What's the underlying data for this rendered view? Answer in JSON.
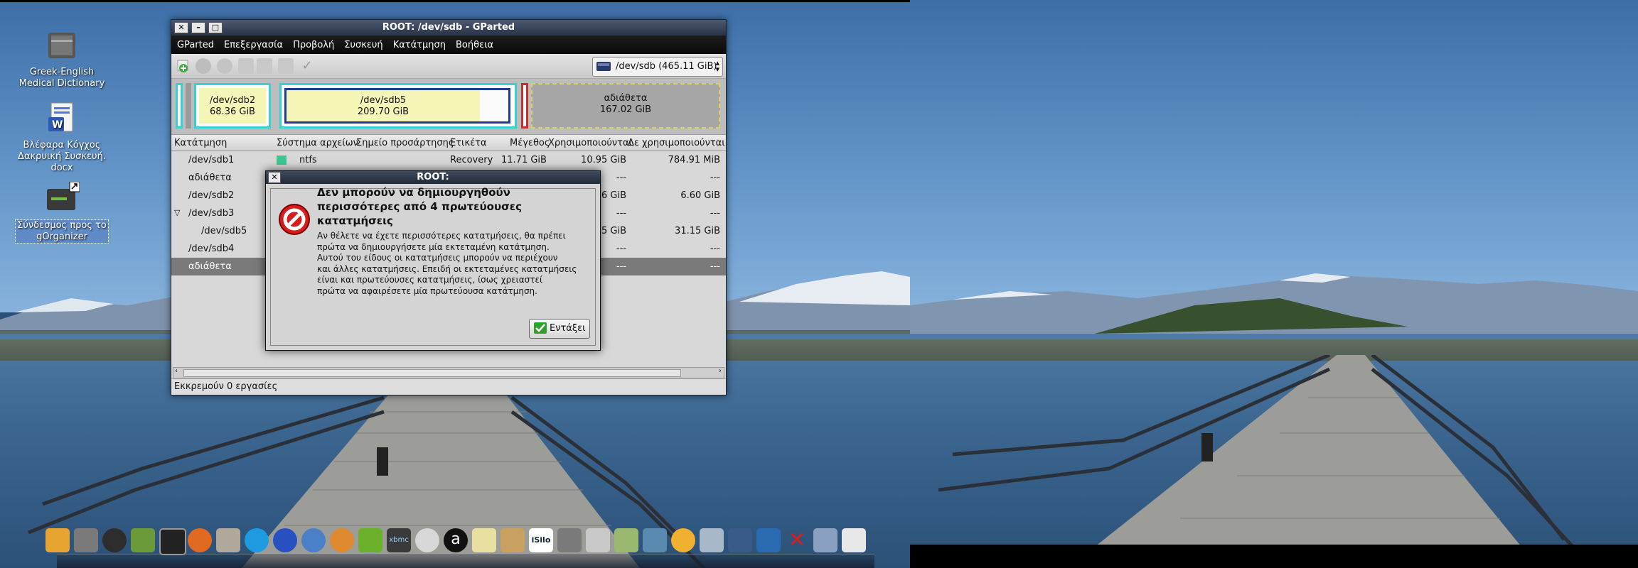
{
  "desktop": {
    "icons": [
      {
        "label_line1": "Greek-English",
        "label_line2": "Medical Dictionary",
        "label_line3": ""
      },
      {
        "label_line1": "Βλέφαρα Κόγχος",
        "label_line2": "Δακρυική Συσκευή.",
        "label_line3": "docx"
      },
      {
        "label_line1": "Σύνδεσμος προς το",
        "label_line2": "gOrganizer",
        "label_line3": ""
      }
    ]
  },
  "window": {
    "title": "ROOT: /dev/sdb - GParted",
    "menu": [
      "GParted",
      "Επεξεργασία",
      "Προβολή",
      "Συσκευή",
      "Κατάτμηση",
      "Βοήθεια"
    ],
    "device_selector": "/dev/sdb   (465.11 GiB)",
    "partition_map": [
      {
        "name": "/dev/sdb2",
        "size": "68.36 GiB"
      },
      {
        "name": "/dev/sdb5",
        "size": "209.70 GiB"
      },
      {
        "name": "αδιάθετα",
        "size": "167.02 GiB"
      }
    ],
    "columns": [
      "Κατάτμηση",
      "Σύστημα αρχείων",
      "Σημείο προσάρτησης",
      "Ετικέτα",
      "Μέγεθος",
      "Χρησιμοποιούνται",
      "Δε χρησιμοποιούνται"
    ],
    "rows": [
      {
        "partition": "/dev/sdb1",
        "filesystem": "ntfs",
        "label": "Recovery",
        "size": "11.71 GiB",
        "used": "10.95 GiB",
        "unused": "784.91 MiB"
      },
      {
        "partition": "αδιάθετα",
        "filesystem": "",
        "label": "",
        "size": "",
        "used": "---",
        "unused": "---"
      },
      {
        "partition": "/dev/sdb2",
        "filesystem": "",
        "label": "",
        "size": "",
        "used": "6 GiB",
        "unused": "6.60 GiB"
      },
      {
        "partition": "/dev/sdb3",
        "filesystem": "",
        "label": "",
        "size": "",
        "used": "---",
        "unused": "---"
      },
      {
        "partition": "/dev/sdb5",
        "filesystem": "",
        "label": "",
        "size": "",
        "used": "5 GiB",
        "unused": "31.15 GiB"
      },
      {
        "partition": "/dev/sdb4",
        "filesystem": "",
        "label": "",
        "size": "",
        "used": "---",
        "unused": "---"
      },
      {
        "partition": "αδιάθετα",
        "filesystem": "",
        "label": "",
        "size": "",
        "used": "---",
        "unused": "---"
      }
    ],
    "status": "Εκκρεμούν 0 εργασίες"
  },
  "dialog": {
    "title": "ROOT:",
    "heading": "Δεν μπορούν να δημιουργηθούν περισσότερες από 4 πρωτεύουσες κατατμήσεις",
    "body_lines": [
      "Αν θέλετε να έχετε περισσότερες κατατμήσεις, θα πρέπει",
      "πρώτα να δημιουργήσετε μία εκτεταμένη κατάτμηση.",
      "Αυτού του είδους οι κατατμήσεις μπορούν να περιέχουν",
      "και άλλες κατατμήσεις. Επειδή οι εκτεταμένες κατατμήσεις",
      "είναι και πρωτεύουσες κατατμήσεις, ίσως χρειαστεί",
      "πρώτα να αφαιρέσετε μία πρωτεύουσα κατάτμηση."
    ],
    "ok_label": "Εντάξει"
  },
  "dock": {
    "items": [
      "gimp-icon",
      "drive-icon",
      "tux-icon",
      "settings-icon",
      "terminal-icon",
      "firefox-icon",
      "installer-icon",
      "skype-icon",
      "globe-icon",
      "world-icon",
      "ubuntu-icon",
      "nvidia-icon",
      "xbmc-icon",
      "apple-icon",
      "a-icon",
      "tomboy-icon",
      "calendar-icon",
      "ibilo-icon",
      "camera-icon",
      "printer-icon",
      "photos-icon",
      "files-icon",
      "clock-icon",
      "user-icon",
      "monitor-icon",
      "folder-icon",
      "trash-icon",
      "network-icon",
      "mail-icon"
    ],
    "ibilo_label": "iSilo",
    "xbmc_label": "xbmc",
    "a_label": "a"
  },
  "colors": {
    "sdb2_border": "#3ad0d0",
    "sdb5_border": "#1d3c8c",
    "unallocated_border": "#d9d36a",
    "selected_row": "#7a7a7a"
  }
}
